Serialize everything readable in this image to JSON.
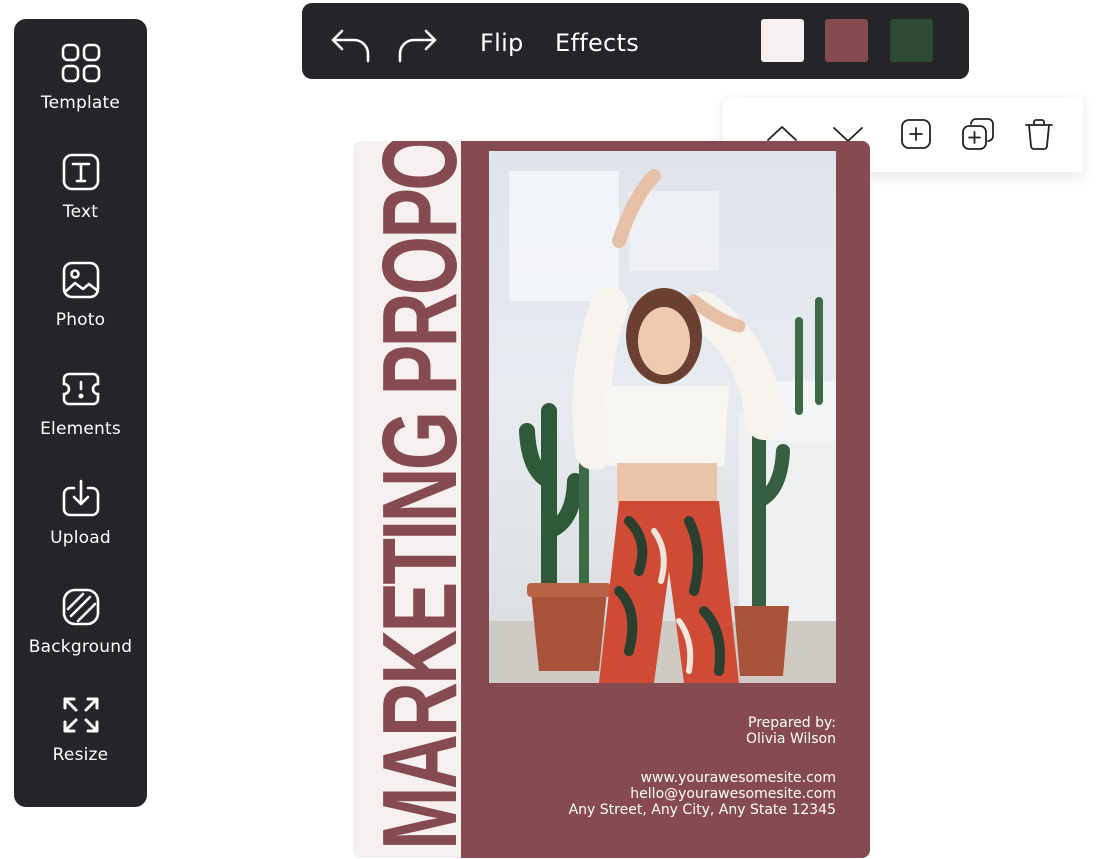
{
  "sidebar": {
    "items": [
      {
        "label": "Template",
        "icon": "template-grid-icon"
      },
      {
        "label": "Text",
        "icon": "text-icon"
      },
      {
        "label": "Photo",
        "icon": "photo-icon"
      },
      {
        "label": "Elements",
        "icon": "elements-icon"
      },
      {
        "label": "Upload",
        "icon": "upload-icon"
      },
      {
        "label": "Background",
        "icon": "background-icon"
      },
      {
        "label": "Resize",
        "icon": "resize-icon"
      }
    ]
  },
  "toolbar": {
    "undo_icon": "undo-icon",
    "redo_icon": "redo-icon",
    "flip_label": "Flip",
    "effects_label": "Effects",
    "swatches": [
      "#f6f0f0",
      "#864b51",
      "#2c4a34"
    ]
  },
  "layer_bar": {
    "icons": [
      "chevron-up-icon",
      "chevron-down-icon",
      "add-icon",
      "duplicate-icon",
      "trash-icon"
    ]
  },
  "design": {
    "title": "MARKETING PROPOSAL",
    "prepared_by_label": "Prepared by:",
    "prepared_by_name": "Olivia Wilson",
    "website": "www.yourawesomesite.com",
    "email": "hello@yourawesomesite.com",
    "address": "Any Street, Any City, Any State 12345",
    "colors": {
      "light": "#f6f0f0",
      "maroon": "#864b51",
      "green": "#2c4a34",
      "dark": "#242429"
    }
  }
}
